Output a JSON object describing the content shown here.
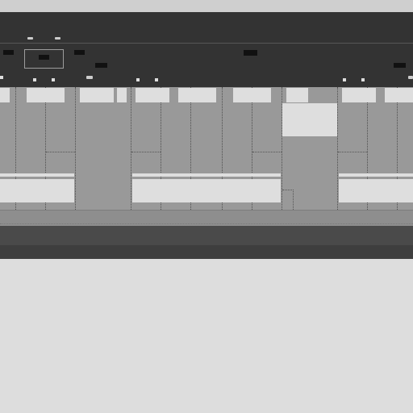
{
  "app": {
    "title": "",
    "description": ""
  },
  "colors": {
    "header_bg": "#333333",
    "content_bg": "#999999",
    "pane_bg": "#dedede",
    "page_bg": "#dddddd"
  },
  "toolbar": {
    "selected_tool": ""
  }
}
